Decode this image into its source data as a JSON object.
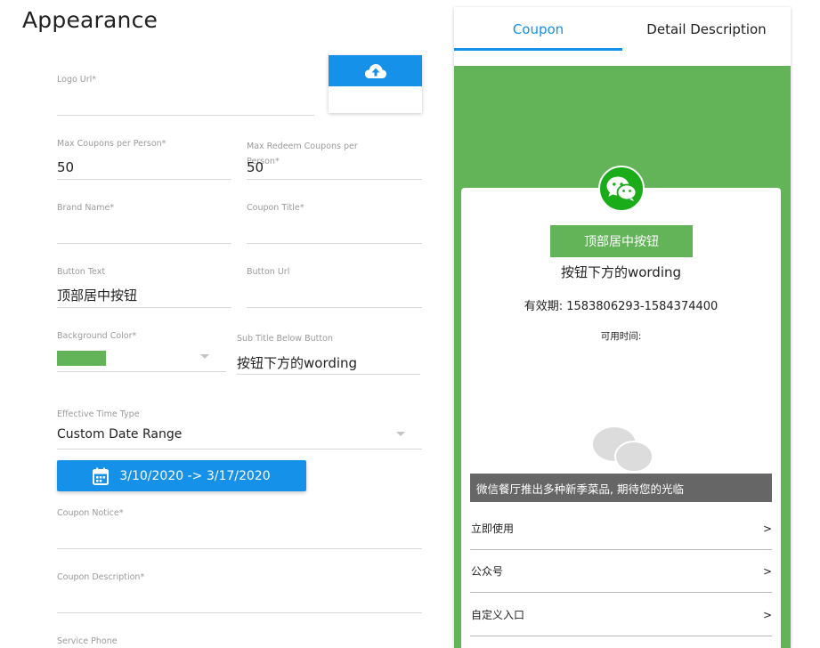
{
  "page_title": "Appearance",
  "form": {
    "logo_url": {
      "label": "Logo Url*",
      "value": ""
    },
    "max_coupons": {
      "label": "Max Coupons per Person*",
      "value": "50"
    },
    "max_redeem": {
      "label": "Max Redeem Coupons per Person*",
      "value": "50"
    },
    "brand_name": {
      "label": "Brand Name*",
      "value": ""
    },
    "coupon_title": {
      "label": "Coupon Title*",
      "value": ""
    },
    "button_text": {
      "label": "Button Text",
      "value": "顶部居中按钮"
    },
    "button_url": {
      "label": "Button Url",
      "value": ""
    },
    "background_color": {
      "label": "Background Color*",
      "color": "#63b359"
    },
    "sub_title": {
      "label": "Sub Title Below Button",
      "value": "按钮下方的wording"
    },
    "effective_time_type": {
      "label": "Effective Time Type",
      "value": "Custom Date Range"
    },
    "date_range": "3/10/2020 -> 3/17/2020",
    "coupon_notice": {
      "label": "Coupon Notice*",
      "value": ""
    },
    "coupon_description": {
      "label": "Coupon Description*",
      "value": ""
    },
    "service_phone": {
      "label": "Service Phone",
      "value": ""
    }
  },
  "preview": {
    "tabs": [
      "Coupon",
      "Detail Description"
    ],
    "active_tab": "Coupon",
    "center_button": "顶部居中按钮",
    "subtitle": "按钮下方的wording",
    "validity": "有效期: 1583806293-1584374400",
    "usable_time": "可用时间:",
    "notice": "微信餐厅推出多种新季菜品, 期待您的光临",
    "rows": [
      {
        "label": "立即使用",
        "arrow": ">"
      },
      {
        "label": "公众号",
        "arrow": ">"
      },
      {
        "label": "自定义入口",
        "arrow": ">"
      }
    ]
  },
  "colors": {
    "accent": "#1591ea",
    "card_background": "#63b359",
    "wechat_green": "#1aad19"
  },
  "icons": {
    "upload": "cloud-upload-icon",
    "calendar": "calendar-icon",
    "logo": "wechat-icon",
    "dropdown": "dropdown-caret-icon"
  }
}
